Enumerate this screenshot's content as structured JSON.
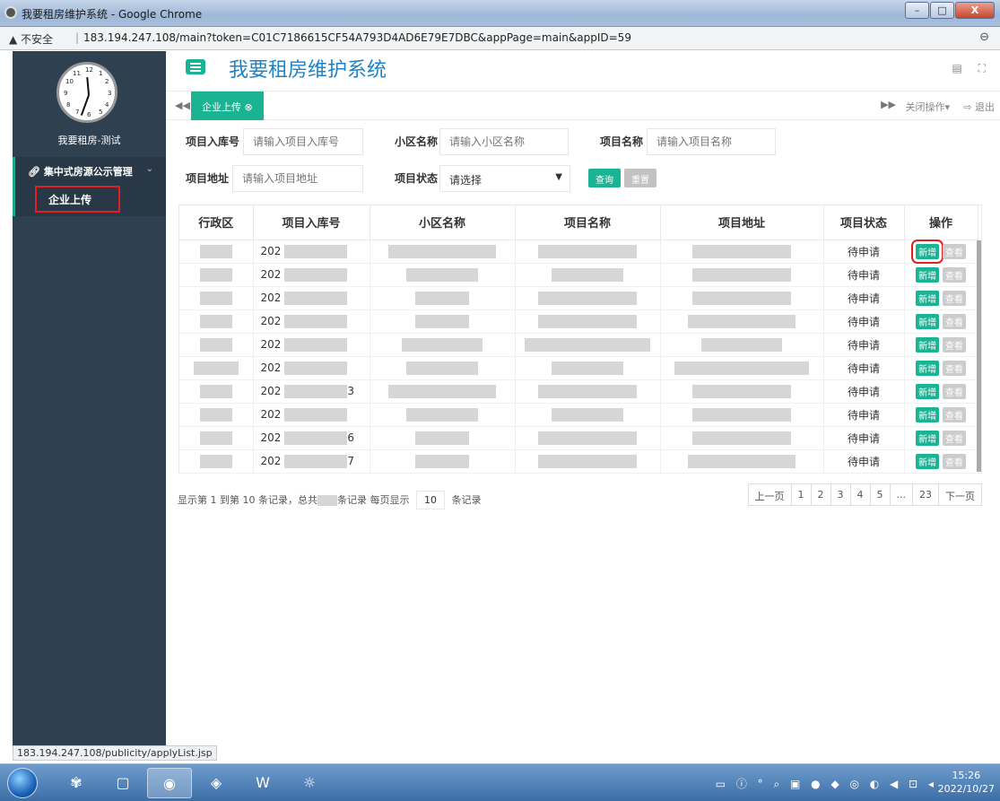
{
  "window": {
    "title": "我要租房维护系统 - Google Chrome",
    "min": "–",
    "max": "□",
    "close": "X"
  },
  "address": {
    "warning": "▲ 不安全",
    "sep": "|",
    "url": "183.194.247.108/main?token=C01C7186615CF54A793D4AD6E79E7DBC&appPage=main&appID=59",
    "zoom_icon": "⊖"
  },
  "sidebar": {
    "user": "我要租房-测试",
    "group_label": "集中式房源公示管理",
    "group_icon": "link-icon",
    "chevron": "⌄",
    "sub_item": "企业上传"
  },
  "header": {
    "app_title": "我要租房维护系统",
    "icons": "▤ ⛶"
  },
  "tabs": {
    "prev": "◀◀",
    "active_tab": "企业上传 ⊗",
    "next": "▶▶",
    "close_ops": "关闭操作▾",
    "logout": "⇨ 退出"
  },
  "filters": {
    "row1": [
      {
        "label": "项目入库号",
        "placeholder": "请输入项目入库号"
      },
      {
        "label": "小区名称",
        "placeholder": "请输入小区名称"
      },
      {
        "label": "项目名称",
        "placeholder": "请输入项目名称"
      }
    ],
    "row2": {
      "address_label": "项目地址",
      "address_placeholder": "请输入项目地址",
      "status_label": "项目状态",
      "status_value": "请选择",
      "query": "查询",
      "reset": "重置"
    }
  },
  "table": {
    "headers": [
      "行政区",
      "项目入库号",
      "小区名称",
      "项目名称",
      "项目地址",
      "项目状态",
      "操作"
    ],
    "rows": [
      {
        "code": "202",
        "suffix": "",
        "status": "待申请"
      },
      {
        "code": "202",
        "suffix": "",
        "status": "待申请"
      },
      {
        "code": "202",
        "suffix": "",
        "status": "待申请"
      },
      {
        "code": "202",
        "suffix": "",
        "status": "待申请"
      },
      {
        "code": "202",
        "suffix": "",
        "status": "待申请"
      },
      {
        "code": "202",
        "suffix": "",
        "status": "待申请"
      },
      {
        "code": "202",
        "suffix": "3",
        "status": "待申请"
      },
      {
        "code": "202",
        "suffix": "",
        "status": "待申请"
      },
      {
        "code": "202",
        "suffix": "6",
        "status": "待申请"
      },
      {
        "code": "202",
        "suffix": "7",
        "status": "待申请"
      }
    ],
    "add_label": "新增",
    "view_label": "查看"
  },
  "pagination": {
    "info_prefix": "显示第 1 到第 10 条记录，总共",
    "info_suffix": "条记录 每页显示",
    "page_size": "10",
    "records": "条记录",
    "pages": [
      "上一页",
      "1",
      "2",
      "3",
      "4",
      "5",
      "...",
      "23",
      "下一页"
    ]
  },
  "status_url": "183.194.247.108/publicity/applyList.jsp",
  "taskbar": {
    "time": "15:26",
    "date": "2022/10/27",
    "tray": "▭ ⓘ ° ⌕ ▣ ● ◆ ◎ ◐ ◀ ⊡ ◂"
  },
  "colors": {
    "sidebar": "#2f4050",
    "accent": "#1ab394",
    "title_blue": "#1c84c6",
    "highlight": "#e02020"
  }
}
